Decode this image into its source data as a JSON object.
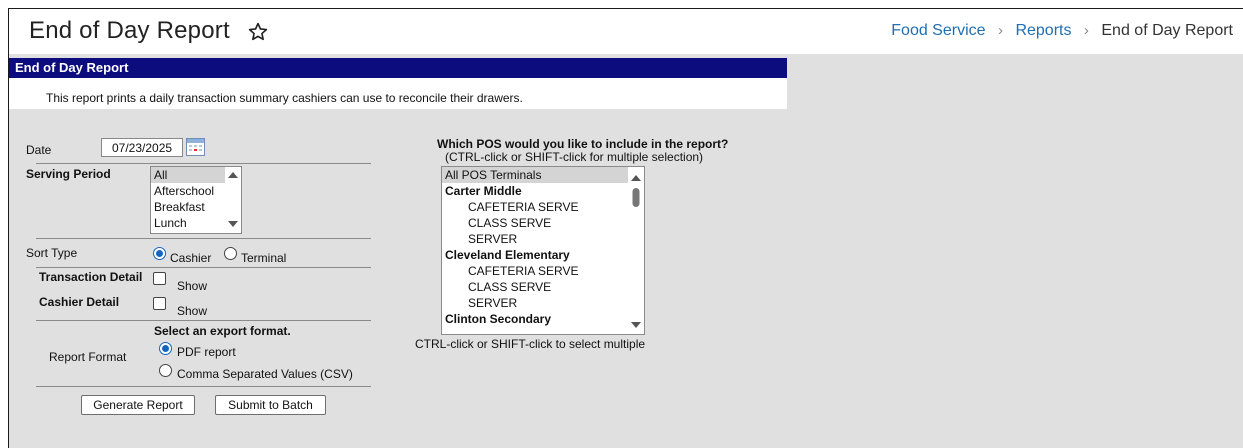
{
  "header": {
    "title": "End of Day Report",
    "breadcrumb": [
      "Food Service",
      "Reports",
      "End of Day Report"
    ]
  },
  "section": {
    "title": "End of Day Report",
    "description": "This report prints a daily transaction summary cashiers can use to reconcile their drawers."
  },
  "form": {
    "date_label": "Date",
    "date_value": "07/23/2025",
    "serving_period_label": "Serving Period",
    "serving_periods": [
      "All",
      "Afterschool",
      "Breakfast",
      "Lunch"
    ],
    "serving_period_selected": "All",
    "sort_type_label": "Sort Type",
    "sort_options": [
      "Cashier",
      "Terminal"
    ],
    "sort_selected": "Cashier",
    "transaction_detail_label": "Transaction Detail",
    "cashier_detail_label": "Cashier Detail",
    "show_label": "Show",
    "export_heading": "Select an export format.",
    "report_format_label": "Report Format",
    "format_options": [
      "PDF report",
      "Comma Separated Values (CSV)"
    ],
    "format_selected": "PDF report",
    "generate_button": "Generate Report",
    "batch_button": "Submit to Batch"
  },
  "pos": {
    "question": "Which POS would you like to include in the report?",
    "hint": "(CTRL-click or SHIFT-click for multiple selection)",
    "footer_hint": "CTRL-click or SHIFT-click to select multiple",
    "options": [
      {
        "label": "All POS Terminals",
        "kind": "selected"
      },
      {
        "label": "Carter Middle",
        "kind": "group"
      },
      {
        "label": "CAFETERIA SERVE",
        "kind": "item"
      },
      {
        "label": "CLASS SERVE",
        "kind": "item"
      },
      {
        "label": "SERVER",
        "kind": "item"
      },
      {
        "label": "Cleveland Elementary",
        "kind": "group"
      },
      {
        "label": "CAFETERIA SERVE",
        "kind": "item"
      },
      {
        "label": "CLASS SERVE",
        "kind": "item"
      },
      {
        "label": "SERVER",
        "kind": "item"
      },
      {
        "label": "Clinton Secondary",
        "kind": "group"
      }
    ]
  },
  "colors": {
    "section_bar": "#0c0c7e",
    "link": "#1f6fb2",
    "radio_selected": "#1565c0",
    "panel_background": "#e0e0e0"
  },
  "icons": [
    "star-outline-icon",
    "calendar-icon",
    "chevron-right-icon",
    "scroll-up-icon",
    "scroll-down-icon"
  ]
}
